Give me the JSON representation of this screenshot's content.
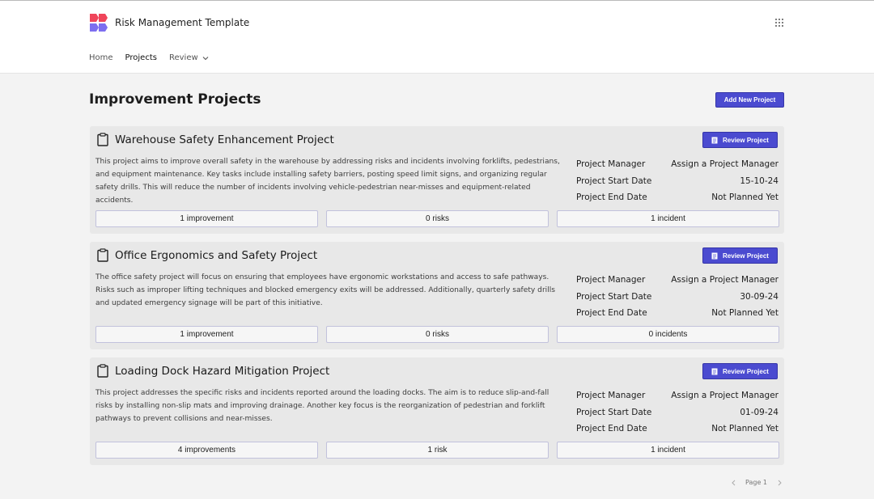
{
  "app": {
    "title": "Risk Management Template"
  },
  "nav": {
    "items": [
      {
        "label": "Home"
      },
      {
        "label": "Projects"
      },
      {
        "label": "Review"
      }
    ]
  },
  "page": {
    "title": "Improvement Projects",
    "add_label": "Add New Project"
  },
  "card_labels": {
    "review": "Review Project",
    "manager": "Project Manager",
    "start": "Project Start Date",
    "end": "Project End Date"
  },
  "projects": [
    {
      "title": "Warehouse Safety Enhancement Project",
      "description": "This project aims to improve overall safety in the warehouse by addressing risks and incidents involving forklifts, pedestrians, and equipment maintenance. Key tasks include installing safety barriers, posting speed limit signs, and organizing regular safety drills. This will reduce the number of incidents involving vehicle-pedestrian near-misses and equipment-related accidents.",
      "manager": "Assign a Project Manager",
      "start": "15-10-24",
      "end": "Not Planned Yet",
      "improvements": "1 improvement",
      "risks": "0 risks",
      "incidents": "1 incident"
    },
    {
      "title": "Office Ergonomics and Safety Project",
      "description": "The office safety project will focus on ensuring that employees have ergonomic workstations and access to safe pathways. Risks such as improper lifting techniques and blocked emergency exits will be addressed. Additionally, quarterly safety drills and updated emergency signage will be part of this initiative.",
      "manager": "Assign a Project Manager",
      "start": "30-09-24",
      "end": "Not Planned Yet",
      "improvements": "1 improvement",
      "risks": "0 risks",
      "incidents": "0 incidents"
    },
    {
      "title": "Loading Dock Hazard Mitigation Project",
      "description": "This project addresses the specific risks and incidents reported around the loading docks. The aim is to reduce slip-and-fall risks by installing non-slip mats and improving drainage. Another key focus is the reorganization of pedestrian and forklift pathways to prevent collisions and near-misses.",
      "manager": "Assign a Project Manager",
      "start": "01-09-24",
      "end": "Not Planned Yet",
      "improvements": "4 improvements",
      "risks": "1 risk",
      "incidents": "1 incident"
    }
  ],
  "pager": {
    "label": "Page 1"
  },
  "colors": {
    "accent": "#4b4bd0",
    "logo_red": "#f0455a",
    "logo_purple": "#7d6ef0"
  }
}
